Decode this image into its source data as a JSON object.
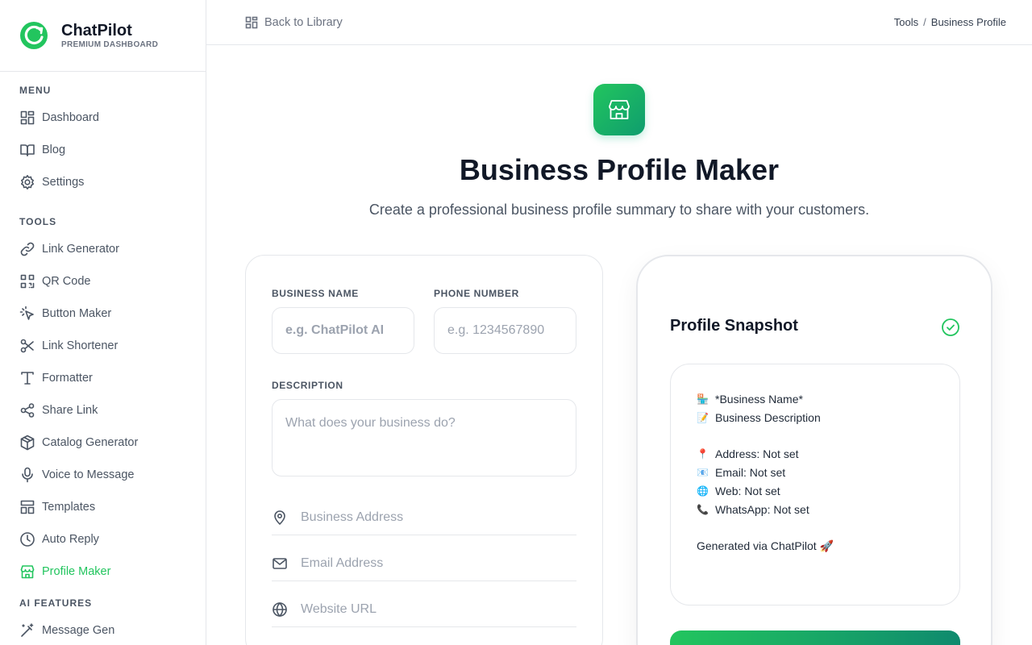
{
  "brand": {
    "name": "ChatPilot",
    "subtitle": "PREMIUM DASHBOARD"
  },
  "sidebar": {
    "menu_title": "MENU",
    "menu_items": [
      {
        "label": "Dashboard",
        "icon": "dashboard-icon"
      },
      {
        "label": "Blog",
        "icon": "book-icon"
      },
      {
        "label": "Settings",
        "icon": "gear-icon"
      }
    ],
    "tools_title": "TOOLS",
    "tool_items": [
      {
        "label": "Link Generator",
        "icon": "link-icon"
      },
      {
        "label": "QR Code",
        "icon": "qr-icon"
      },
      {
        "label": "Button Maker",
        "icon": "pointer-icon"
      },
      {
        "label": "Link Shortener",
        "icon": "scissors-icon"
      },
      {
        "label": "Formatter",
        "icon": "type-icon"
      },
      {
        "label": "Share Link",
        "icon": "share-icon"
      },
      {
        "label": "Catalog Generator",
        "icon": "box-icon"
      },
      {
        "label": "Voice to Message",
        "icon": "mic-icon"
      },
      {
        "label": "Templates",
        "icon": "layout-icon"
      },
      {
        "label": "Auto Reply",
        "icon": "clock-icon"
      },
      {
        "label": "Profile Maker",
        "icon": "store-icon",
        "active": true
      }
    ],
    "ai_title": "AI FEATURES",
    "ai_items": [
      {
        "label": "Message Gen",
        "icon": "wand-icon"
      }
    ]
  },
  "header": {
    "back_label": "Back to Library",
    "breadcrumb": [
      "Tools",
      "Business Profile"
    ]
  },
  "hero": {
    "title": "Business Profile Maker",
    "subtitle": "Create a professional business profile summary to share with your customers."
  },
  "form": {
    "business_name_label": "BUSINESS NAME",
    "business_name_placeholder": "e.g. ChatPilot AI",
    "phone_label": "PHONE NUMBER",
    "phone_placeholder": "e.g. 1234567890",
    "description_label": "DESCRIPTION",
    "description_placeholder": "What does your business do?",
    "address_placeholder": "Business Address",
    "email_placeholder": "Email Address",
    "website_placeholder": "Website URL"
  },
  "preview": {
    "title": "Profile Snapshot",
    "lines": [
      {
        "emoji": "🏪",
        "text": "*Business Name*"
      },
      {
        "emoji": "📝",
        "text": "Business Description"
      }
    ],
    "contact_lines": [
      {
        "emoji": "📍",
        "text": "Address: Not set"
      },
      {
        "emoji": "📧",
        "text": "Email: Not set"
      },
      {
        "emoji": "🌐",
        "text": "Web: Not set"
      },
      {
        "emoji": "📞",
        "text": "WhatsApp: Not set"
      }
    ],
    "footer": "Generated via ChatPilot 🚀"
  },
  "colors": {
    "accent": "#22c55e",
    "accent_dark": "#0f8a6e",
    "border": "#e5e7eb"
  }
}
